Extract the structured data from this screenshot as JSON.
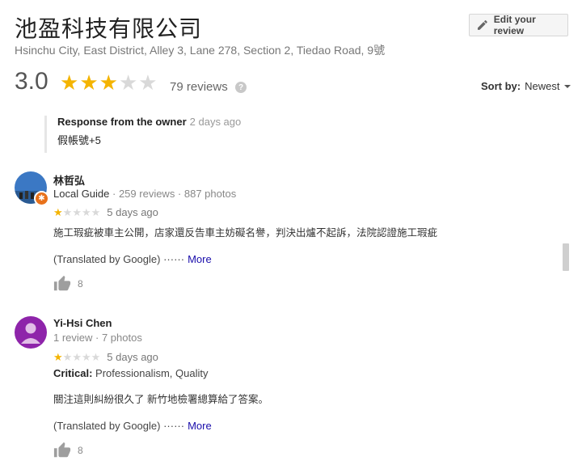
{
  "business": {
    "name": "池盈科技有限公司",
    "address": "Hsinchu City, East District, Alley 3, Lane 278, Section 2, Tiedao Road, 9號"
  },
  "edit_review_label": "Edit your review",
  "summary": {
    "rating": "3.0",
    "stars_filled": 3,
    "reviews": "79 reviews",
    "help": "?"
  },
  "sort": {
    "label": "Sort by:",
    "value": "Newest"
  },
  "owner_response": {
    "label": "Response from the owner",
    "time": "2 days ago",
    "text": "假帳號+5"
  },
  "reviews": [
    {
      "name": "林哲弘",
      "local_guide": "Local Guide",
      "meta": "· 259 reviews · 887 photos",
      "stars": 1,
      "time": "5 days ago",
      "text": "施工瑕疵被車主公開，店家還反告車主妨礙名譽，判決出爐不起訴，法院認證施工瑕疵",
      "translated": "(Translated by Google) ······",
      "more": "More",
      "likes": "8"
    },
    {
      "name": "Yi-Hsi Chen",
      "meta": "1 review · 7 photos",
      "stars": 1,
      "time": "5 days ago",
      "critical_label": "Critical:",
      "critical_value": "Professionalism, Quality",
      "text": "關注這則糾紛很久了 新竹地檢署總算給了答案。",
      "translated": "(Translated by Google) ······",
      "more": "More",
      "likes": "8"
    }
  ],
  "colors": {
    "star": "#f4b400",
    "star_empty": "#d9d9d9",
    "link": "#1a0dab",
    "avatar2": "#8e24aa"
  }
}
